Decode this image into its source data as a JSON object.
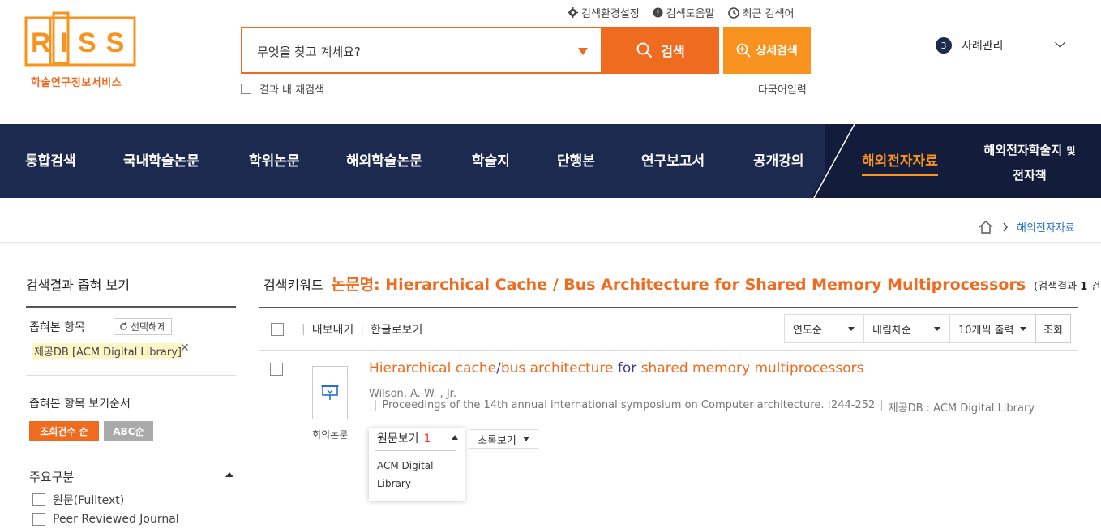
{
  "logo": {
    "letters": "RISS",
    "subtitle": "학술연구정보서비스"
  },
  "top_links": [
    {
      "icon": "gear-icon",
      "label": "검색환경설정"
    },
    {
      "icon": "alert-circle-icon",
      "label": "검색도움말"
    },
    {
      "icon": "clock-icon",
      "label": "최근 검색어"
    }
  ],
  "search": {
    "placeholder": "무엇을 찾고 계세요?",
    "search_button": "검색",
    "advanced_button": "상세검색",
    "within_results": "결과 내 재검색",
    "multilang": "다국어입력"
  },
  "user": {
    "badge_count": "3",
    "label": "사례관리"
  },
  "nav": {
    "items": [
      "통합검색",
      "국내학술논문",
      "학위논문",
      "해외학술논문",
      "학술지",
      "단행본",
      "연구보고서",
      "공개강의"
    ],
    "active": "해외전자자료",
    "last_line1": "해외전자학술지",
    "last_line1_small": "및",
    "last_line2": "전자책"
  },
  "breadcrumb": {
    "current": "해외전자자료"
  },
  "sidebar": {
    "title": "검색결과 좁혀 보기",
    "narrowed_label": "좁혀본 항목",
    "reset_label": "선택해제",
    "filter_tag": "제공DB [ACM Digital Library]",
    "order_label": "좁혀본 항목 보기순서",
    "order_btn1": "조회건수 순",
    "order_btn2": "ABC순",
    "category_title": "주요구분",
    "category_items": [
      "원문(Fulltext)",
      "Peer Reviewed Journal"
    ]
  },
  "results": {
    "keyword_label": "검색키워드",
    "keyword_value": "논문명: Hierarchical Cache / Bus Architecture for Shared Memory Multiprocessors",
    "count_prefix": "(검색결과 ",
    "count": "1",
    "count_suffix": " 건)",
    "toolbar": {
      "export": "내보내기",
      "korean_view": "한글로보기",
      "sort1": "연도순",
      "sort2": "내림차순",
      "per_page": "10개씩 출력",
      "lookup": "조회"
    },
    "item": {
      "type": "회의논문",
      "title_parts": [
        "Hierarchical cache",
        "/",
        "bus architecture",
        " for ",
        "shared memory multiprocessors"
      ],
      "author": "Wilson, A. W. , Jr.",
      "source": "Proceedings of the 14th annual international symposium on Computer architecture. :244-252",
      "provider": "제공DB : ACM Digital Library",
      "original_label": "원문보기",
      "original_count": "1",
      "original_option": "ACM Digital Library",
      "abstract_label": "초록보기"
    }
  },
  "colors": {
    "accent": "#ee6b1f",
    "accent_light": "#f7931e",
    "nav_bg": "#1d2a4f"
  }
}
